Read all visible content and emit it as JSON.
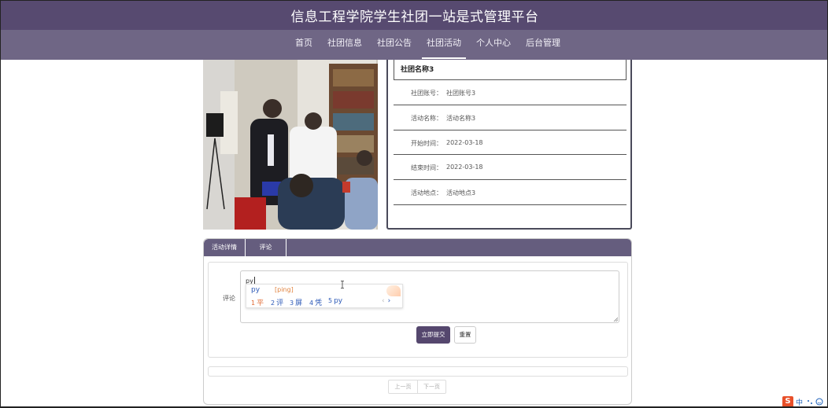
{
  "header": {
    "title": "信息工程学院学生社团一站是式管理平台"
  },
  "nav": {
    "items": [
      {
        "label": "首页",
        "active": false
      },
      {
        "label": "社团信息",
        "active": false
      },
      {
        "label": "社团公告",
        "active": false
      },
      {
        "label": "社团活动",
        "active": true
      },
      {
        "label": "个人中心",
        "active": false
      },
      {
        "label": "后台管理",
        "active": false
      }
    ]
  },
  "detail": {
    "name": "社团名称3",
    "fields": [
      {
        "label": "社团账号：",
        "value": "社团账号3"
      },
      {
        "label": "活动名称：",
        "value": "活动名称3"
      },
      {
        "label": "开始时间：",
        "value": "2022-03-18"
      },
      {
        "label": "结束时间：",
        "value": "2022-03-18"
      },
      {
        "label": "活动地点：",
        "value": "活动地点3"
      }
    ]
  },
  "tabs": [
    {
      "label": "活动详情",
      "active": true
    },
    {
      "label": "评论",
      "active": false
    }
  ],
  "comment": {
    "label": "评论",
    "input_value": "py",
    "submit_label": "立即提交",
    "reset_label": "重置"
  },
  "ime": {
    "composition": "py",
    "pinyin": "[ping]",
    "candidates": [
      {
        "num": "1",
        "text": "平"
      },
      {
        "num": "2",
        "text": "评"
      },
      {
        "num": "3",
        "text": "屏"
      },
      {
        "num": "4",
        "text": "凭"
      },
      {
        "num": "5",
        "text": "py"
      }
    ],
    "prev": "‹",
    "next": "›"
  },
  "pager": {
    "prev_label": "上一页",
    "next_label": "下一页"
  },
  "tray": {
    "logo": "S",
    "lang": "中"
  },
  "colors": {
    "header": "#574a70",
    "navbar": "#6f6685",
    "tabbar": "#655d7e",
    "submit": "#55476e",
    "ime_highlight": "#e06830",
    "ime_text": "#2c59b7"
  }
}
